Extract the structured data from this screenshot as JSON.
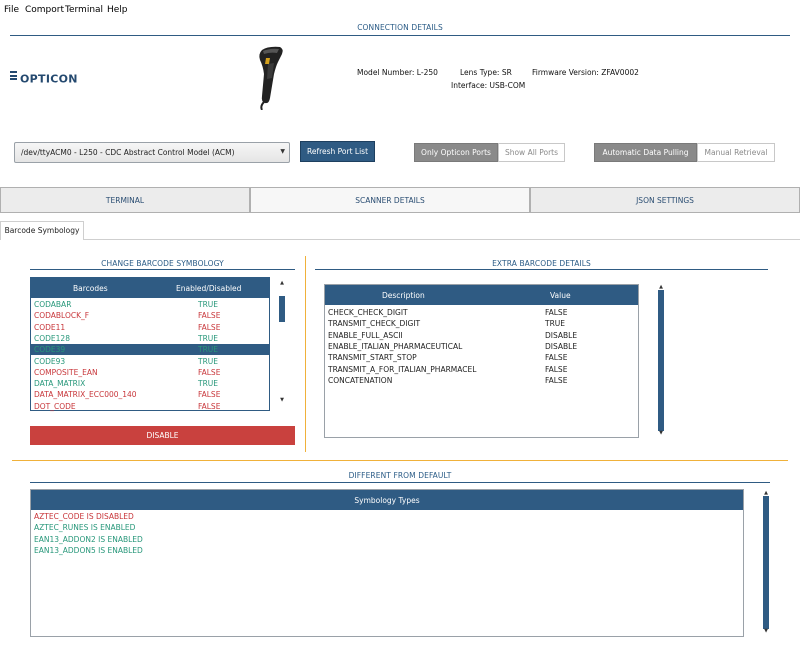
{
  "menu": [
    {
      "label": "File"
    },
    {
      "label": "Comport"
    },
    {
      "label": "Terminal"
    },
    {
      "label": "Help"
    }
  ],
  "connection": {
    "title": "CONNECTION DETAILS",
    "logo": "OPTICON",
    "model_number": "Model Number: L-250",
    "lens_type": "Lens Type: SR",
    "firmware": "Firmware Version: ZFAV0002",
    "interface": "Interface: USB-COM",
    "port_value": "/dev/ttyACM0 - L250 - CDC Abstract Control Model (ACM)",
    "refresh_label": "Refresh Port List",
    "port_filter": {
      "on": "Only Opticon Ports",
      "off": "Show All Ports"
    },
    "pulling": {
      "on": "Automatic Data Pulling",
      "off": "Manual Retrieval"
    }
  },
  "tabs": [
    {
      "label": "TERMINAL"
    },
    {
      "label": "SCANNER DETAILS"
    },
    {
      "label": "JSON SETTINGS"
    }
  ],
  "subtab": "Barcode Symbology",
  "change": {
    "title": "CHANGE BARCODE SYMBOLOGY",
    "columns": [
      "Barcodes",
      "Enabled/Disabled"
    ],
    "rows": [
      {
        "name": "CODABAR",
        "state": "TRUE"
      },
      {
        "name": "CODABLOCK_F",
        "state": "FALSE"
      },
      {
        "name": "CODE11",
        "state": "FALSE"
      },
      {
        "name": "CODE128",
        "state": "TRUE"
      },
      {
        "name": "CODE39",
        "state": "TRUE"
      },
      {
        "name": "CODE93",
        "state": "TRUE"
      },
      {
        "name": "COMPOSITE_EAN",
        "state": "FALSE"
      },
      {
        "name": "DATA_MATRIX",
        "state": "TRUE"
      },
      {
        "name": "DATA_MATRIX_ECC000_140",
        "state": "FALSE"
      },
      {
        "name": "DOT_CODE",
        "state": "FALSE"
      }
    ],
    "disable_label": "DISABLE"
  },
  "extra": {
    "title": "EXTRA BARCODE DETAILS",
    "columns": [
      "Description",
      "Value"
    ],
    "rows": [
      {
        "desc": "CHECK_CHECK_DIGIT",
        "value": "FALSE"
      },
      {
        "desc": "TRANSMIT_CHECK_DIGIT",
        "value": "TRUE"
      },
      {
        "desc": "ENABLE_FULL_ASCII",
        "value": "DISABLE"
      },
      {
        "desc": "ENABLE_ITALIAN_PHARMACEUTICAL",
        "value": "DISABLE"
      },
      {
        "desc": "TRANSMIT_START_STOP",
        "value": "FALSE"
      },
      {
        "desc": "TRANSMIT_A_FOR_ITALIAN_PHARMACEL",
        "value": "FALSE"
      },
      {
        "desc": "CONCATENATION",
        "value": "FALSE"
      }
    ]
  },
  "diff": {
    "title": "DIFFERENT FROM DEFAULT",
    "column": "Symbology Types",
    "rows": [
      {
        "text": "AZTEC_CODE IS DISABLED",
        "color": "#c8363a"
      },
      {
        "text": "AZTEC_RUNES IS ENABLED",
        "color": "#27977a"
      },
      {
        "text": "EAN13_ADDON2 IS ENABLED",
        "color": "#27977a"
      },
      {
        "text": "EAN13_ADDON5 IS ENABLED",
        "color": "#27977a"
      }
    ]
  },
  "colors": {
    "accent": "#2f5b83",
    "true": "#27977a",
    "false": "#c8363a",
    "divider": "#f0b13a"
  }
}
